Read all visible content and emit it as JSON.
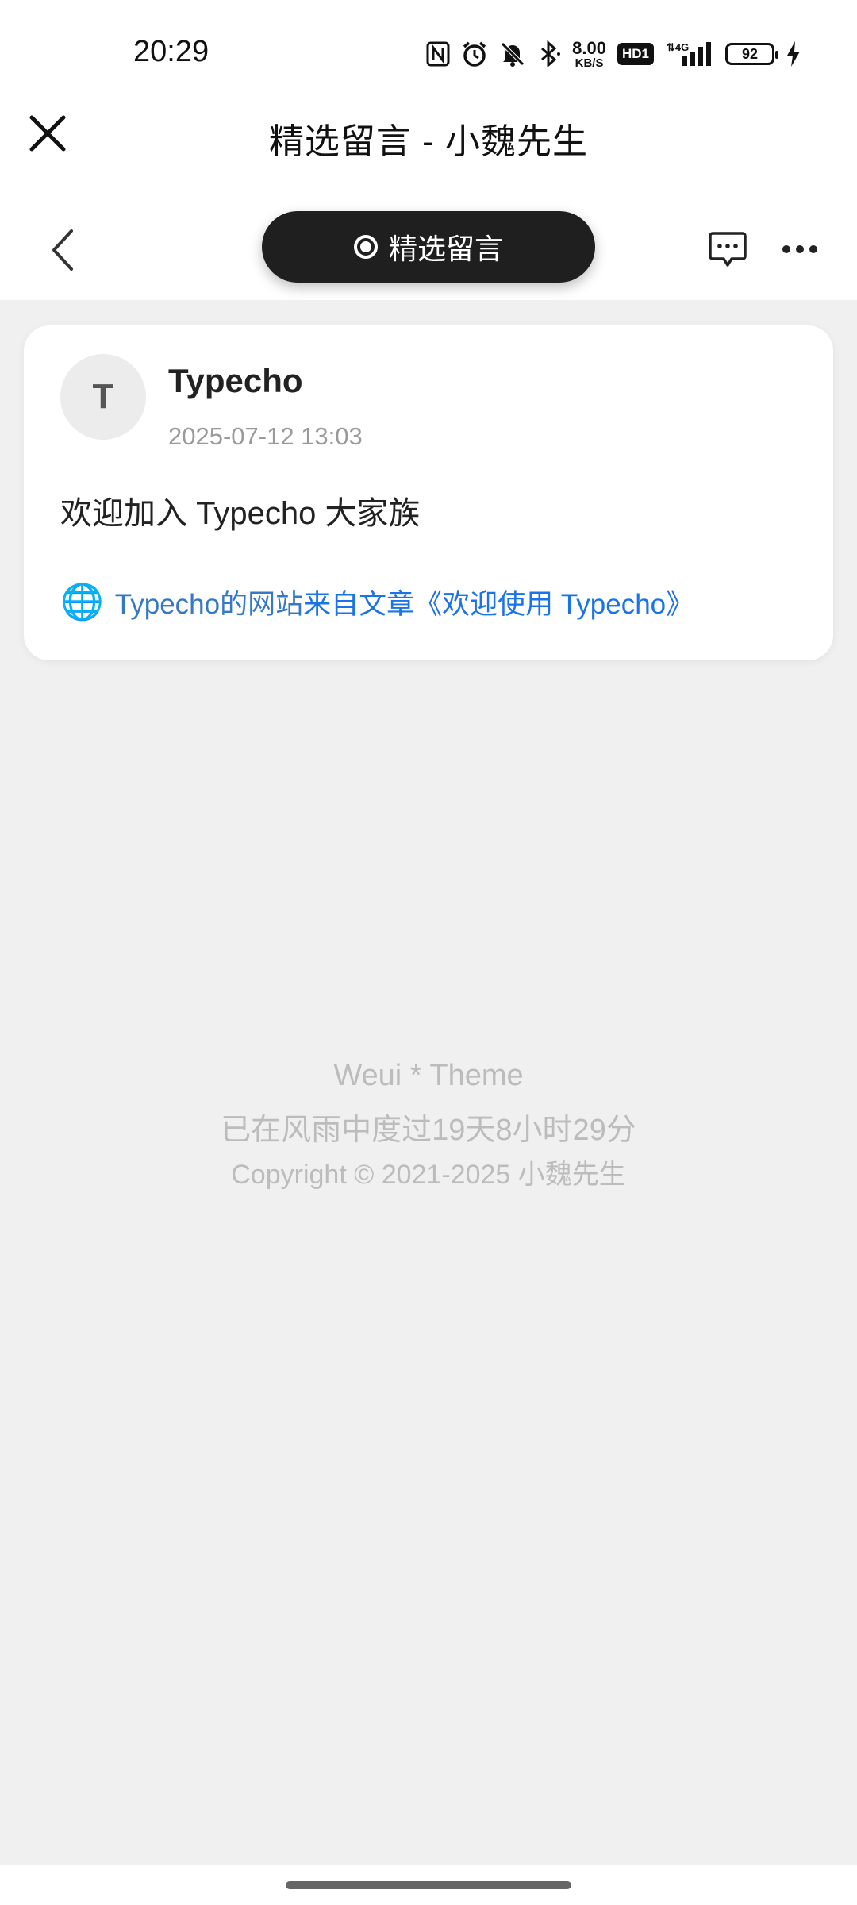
{
  "status_bar": {
    "time": "20:29",
    "net_speed_value": "8.00",
    "net_speed_unit": "KB/S",
    "hd_label": "HD1",
    "signal_label": "4G",
    "battery": "92",
    "icons": [
      "nfc-icon",
      "alarm-icon",
      "mute-icon",
      "bluetooth-icon",
      "signal-icon",
      "charging-icon"
    ]
  },
  "title_bar": {
    "title": "精选留言 - 小魏先生"
  },
  "nav": {
    "pill_label": "精选留言"
  },
  "comment": {
    "avatar_letter": "T",
    "author": "Typecho",
    "time": "2025-07-12 13:03",
    "text": "欢迎加入 Typecho 大家族",
    "site_link": "Typecho的网站",
    "article_link": "来自文章《欢迎使用 Typecho》"
  },
  "footer": {
    "line1": "Weui * Theme",
    "line2": "已在风雨中度过19天8小时29分",
    "line3": "Copyright © 2021-2025 小魏先生"
  }
}
